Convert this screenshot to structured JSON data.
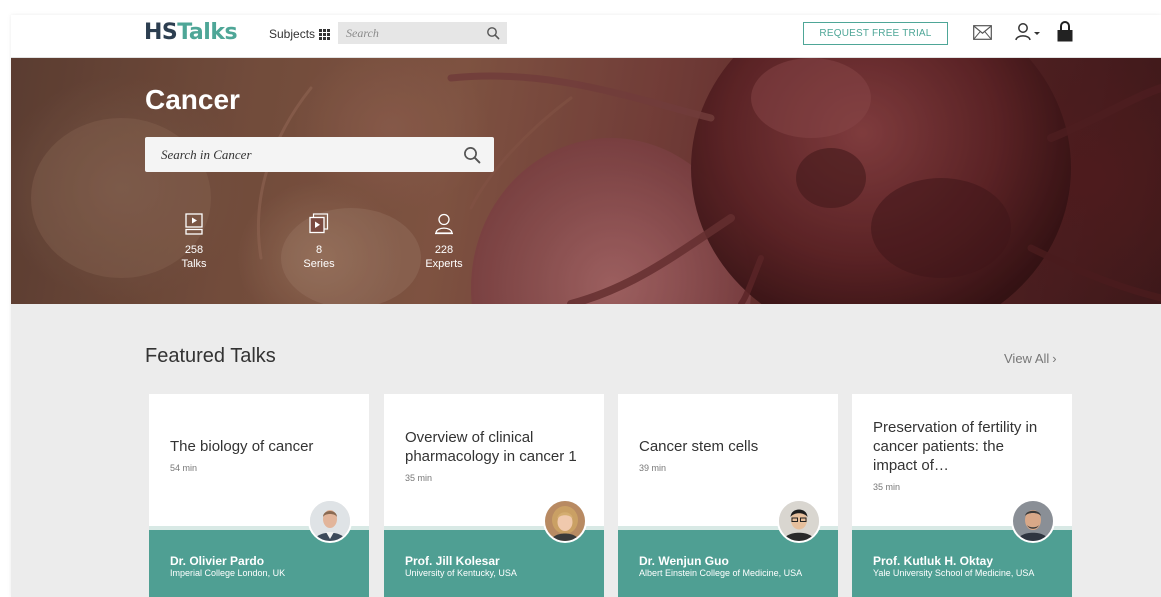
{
  "header": {
    "logo_primary": "HS",
    "logo_secondary": "Talks",
    "subjects_label": "Subjects",
    "search_placeholder": "Search",
    "trial_label": "REQUEST FREE TRIAL",
    "icons": [
      "mail-icon",
      "user-icon",
      "lock-icon",
      "grid-icon",
      "search-icon"
    ]
  },
  "hero": {
    "title": "Cancer",
    "search_placeholder": "Search in Cancer",
    "stats": [
      {
        "icon": "video-icon",
        "value": "258",
        "label": "Talks"
      },
      {
        "icon": "series-icon",
        "value": "8",
        "label": "Series"
      },
      {
        "icon": "expert-icon",
        "value": "228",
        "label": "Experts"
      }
    ]
  },
  "featured": {
    "title": "Featured Talks",
    "view_all_label": "View All",
    "cards": [
      {
        "title": "The biology of cancer",
        "duration": "54 min",
        "speaker": "Dr. Olivier Pardo",
        "affiliation": "Imperial College London, UK"
      },
      {
        "title": "Overview of clinical pharmacology in cancer 1",
        "duration": "35 min",
        "speaker": "Prof. Jill Kolesar",
        "affiliation": "University of Kentucky, USA"
      },
      {
        "title": "Cancer stem cells",
        "duration": "39 min",
        "speaker": "Dr. Wenjun Guo",
        "affiliation": "Albert Einstein College of Medicine, USA"
      },
      {
        "title": "Preservation of fertility in cancer patients: the impact of…",
        "duration": "35 min",
        "speaker": "Prof. Kutluk H. Oktay",
        "affiliation": "Yale University School of Medicine, USA"
      }
    ]
  },
  "colors": {
    "accent": "#4ea697",
    "card_footer": "#4f9f93",
    "logo_dark": "#2c3e50",
    "page_bg": "#ececec"
  }
}
